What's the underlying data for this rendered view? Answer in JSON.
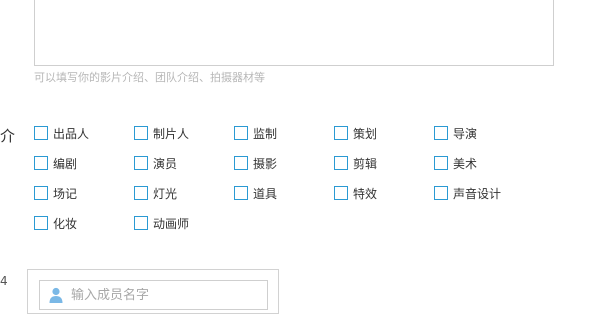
{
  "intro": {
    "hint": "可以填写你的影片介绍、团队介绍、拍摄器材等"
  },
  "roles_section": {
    "label": "介",
    "roles": [
      "出品人",
      "制片人",
      "监制",
      "策划",
      "导演",
      "编剧",
      "演员",
      "摄影",
      "剪辑",
      "美术",
      "场记",
      "灯光",
      "道具",
      "特效",
      "声音设计",
      "化妆",
      "动画师"
    ]
  },
  "members_section": {
    "label": "4",
    "input_placeholder": "输入成员名字",
    "input_value": ""
  },
  "colors": {
    "checkbox_border": "#2b9ad3",
    "hint_text": "#b7b7b7",
    "person_icon": "#7ab8e6"
  }
}
